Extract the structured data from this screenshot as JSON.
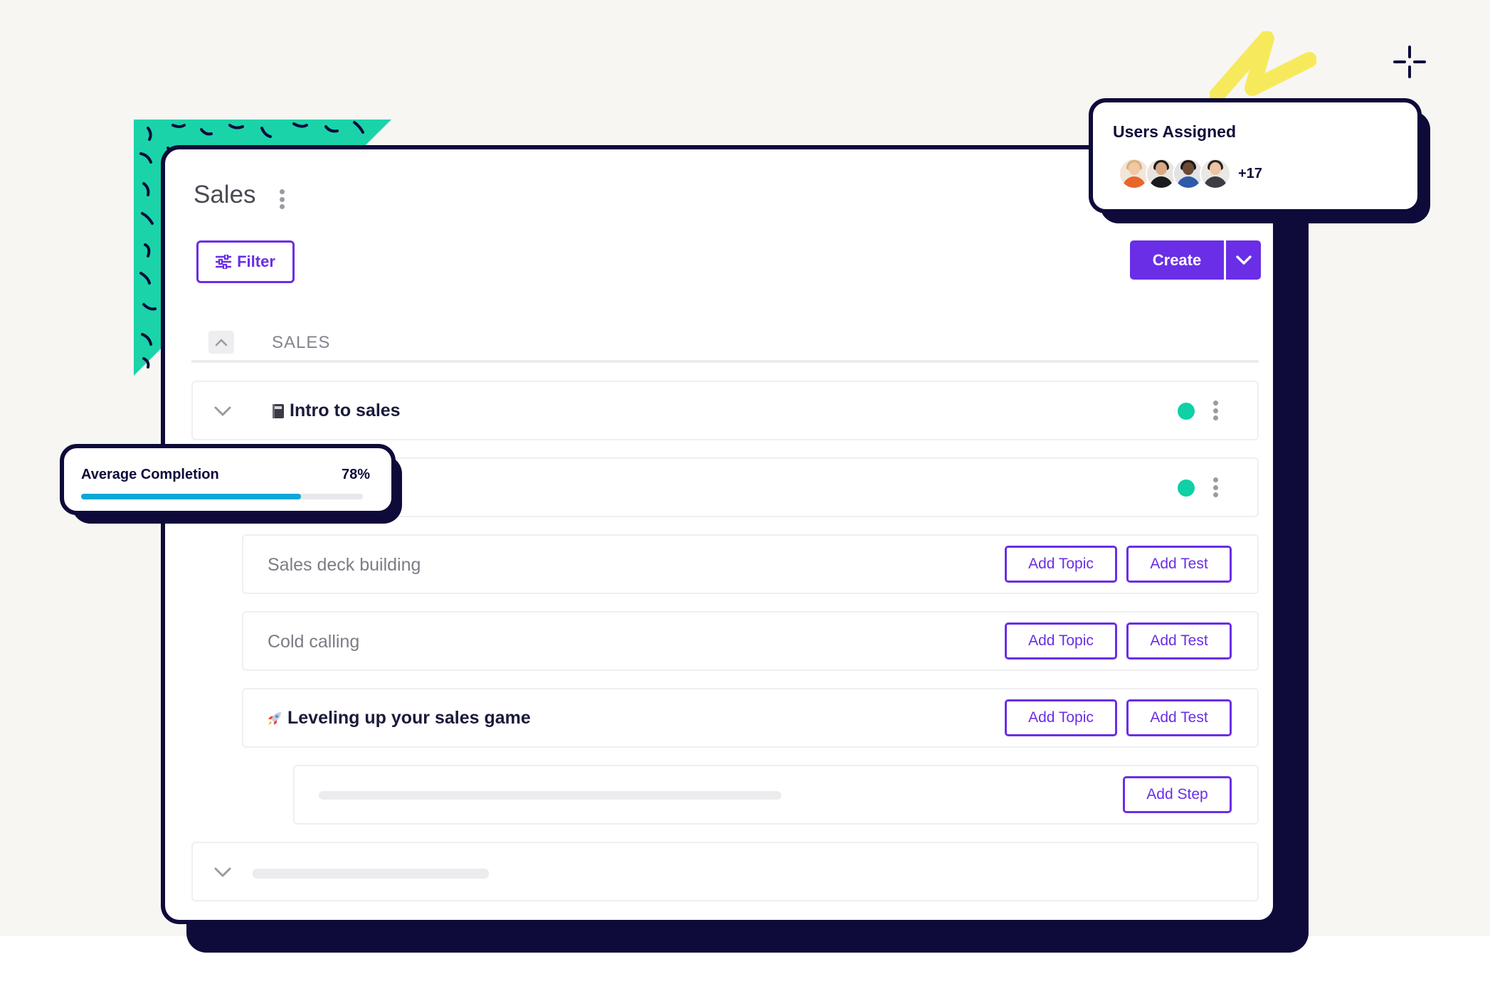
{
  "page": {
    "title": "Sales",
    "filter_label": "Filter",
    "create_label": "Create"
  },
  "section": {
    "label": "SALES"
  },
  "rows": [
    {
      "title": "Intro to sales",
      "icon": "notebook-icon",
      "status": "active",
      "status_color": "#0fd0a6"
    },
    {
      "title": "",
      "status": "active",
      "status_color": "#0fd0a6"
    },
    {
      "title": "Sales deck building",
      "add_topic": "Add Topic",
      "add_test": "Add Test"
    },
    {
      "title": "Cold calling",
      "add_topic": "Add Topic",
      "add_test": "Add Test"
    },
    {
      "title": "Leveling up your sales game",
      "icon": "rocket-icon",
      "add_topic": "Add Topic",
      "add_test": "Add Test"
    },
    {
      "title": "",
      "add_step": "Add Step"
    },
    {
      "title": ""
    }
  ],
  "users_card": {
    "title": "Users Assigned",
    "extra_count": "+17",
    "avatars": [
      "avatar-1",
      "avatar-2",
      "avatar-3",
      "avatar-4"
    ]
  },
  "completion_card": {
    "label": "Average Completion",
    "percent_text": "78%",
    "percent": 78
  },
  "colors": {
    "accent": "#6a2ee6",
    "dark": "#0e0b3a",
    "status": "#0fd0a6",
    "progress": "#0aa8d8",
    "decor_teal": "#1bd3a9",
    "decor_yellow": "#f6ea5c"
  }
}
